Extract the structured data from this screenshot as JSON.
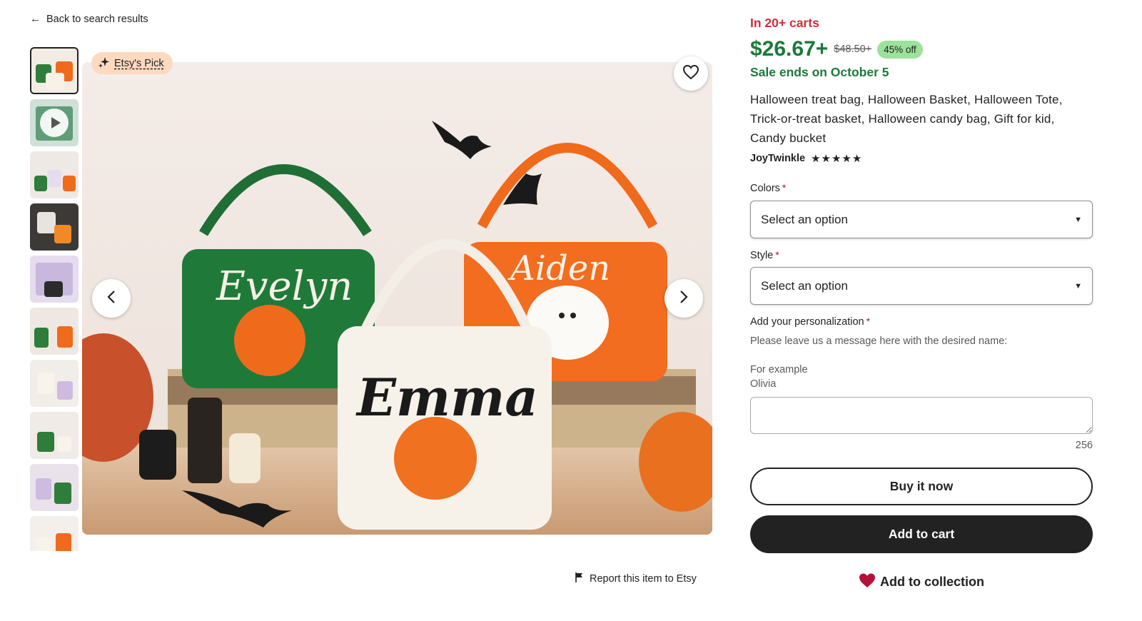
{
  "nav": {
    "back_label": "Back to search results",
    "back_icon": "arrow-left-icon"
  },
  "gallery": {
    "badge_label": "Etsy's Pick",
    "badge_icon": "sparkle-icon",
    "favorite_icon": "heart-outline-icon",
    "prev_icon": "chevron-left-icon",
    "next_icon": "chevron-right-icon",
    "thumbnail_count": 10,
    "video_thumbnail_index": 1,
    "image_names": [
      "Evelyn",
      "Aiden",
      "Emma"
    ]
  },
  "report": {
    "label": "Report this item to Etsy",
    "icon": "flag-icon"
  },
  "listing": {
    "carts": "In 20+ carts",
    "price": "$26.67+",
    "original_price": "$48.50+",
    "discount": "45% off",
    "sale_ends": "Sale ends on October 5",
    "title": "Halloween treat bag, Halloween Basket, Halloween Tote, Trick-or-treat basket, Halloween candy bag, Gift for kid, Candy bucket",
    "shop_name": "JoyTwinkle",
    "stars": "★★★★★",
    "rating": 5
  },
  "options": {
    "colors_label": "Colors",
    "colors_value": "Select an option",
    "style_label": "Style",
    "style_value": "Select an option",
    "required_marker": "*"
  },
  "personalization": {
    "label": "Add your personalization",
    "instructions": "Please leave us a message here with the desired name:",
    "example_label": "For example",
    "example_value": "Olivia",
    "char_count": "256"
  },
  "actions": {
    "buy_now": "Buy it now",
    "add_to_cart": "Add to cart",
    "add_to_collection": "Add to collection"
  },
  "colors": {
    "carts_red": "#d22d3c",
    "price_green": "#1b7a3a",
    "discount_bg": "#9be29b",
    "cart_button": "#222222",
    "heart_red": "#b5123a",
    "badge_bg": "#fdd9c0"
  }
}
